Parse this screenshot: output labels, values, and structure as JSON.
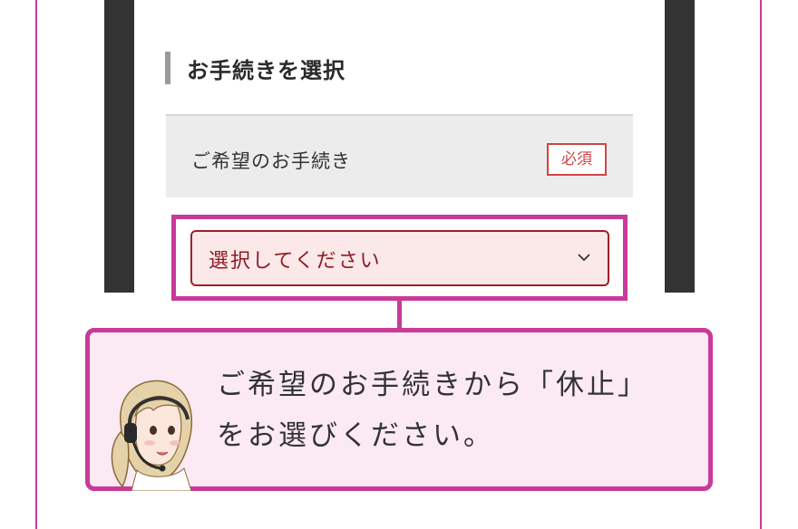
{
  "section": {
    "title": "お手続きを選択"
  },
  "field": {
    "label": "ご希望のお手続き",
    "required_badge": "必須",
    "select_value": "選択してください"
  },
  "callout": {
    "text": "ご希望のお手続きから「休止」\nをお選びください。"
  },
  "icons": {
    "chevron": "chevron-down-icon",
    "avatar": "operator-avatar-icon"
  },
  "colors": {
    "accent": "#c93a9a",
    "callout_bg": "#fbeaf3",
    "select_border": "#a0202a",
    "select_bg": "#fbe8e9",
    "required": "#d04545"
  }
}
